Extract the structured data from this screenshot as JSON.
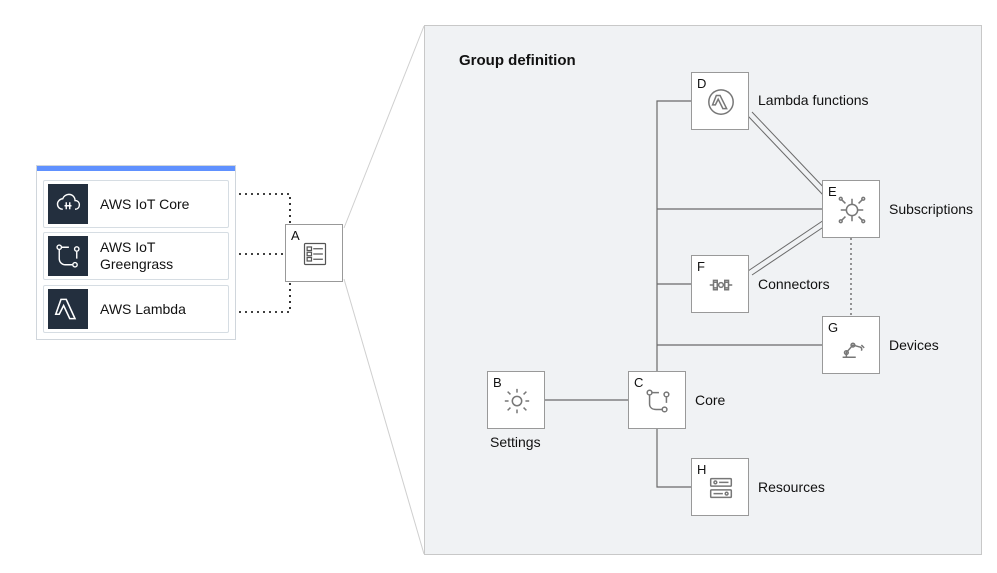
{
  "services_panel": {
    "items": [
      {
        "label": "AWS IoT Core",
        "icon": "aws-iot-core"
      },
      {
        "label": "AWS IoT\nGreengrass",
        "icon": "aws-iot-greengrass"
      },
      {
        "label": "AWS Lambda",
        "icon": "aws-lambda"
      }
    ]
  },
  "node_A": {
    "letter": "A",
    "label": "",
    "icon": "config-list"
  },
  "group": {
    "title": "Group definition",
    "nodes": {
      "B": {
        "letter": "B",
        "label": "Settings",
        "icon": "gear"
      },
      "C": {
        "letter": "C",
        "label": "Core",
        "icon": "core-circuit"
      },
      "D": {
        "letter": "D",
        "label": "Lambda functions",
        "icon": "lambda-outline"
      },
      "E": {
        "letter": "E",
        "label": "Subscriptions",
        "icon": "subscriptions"
      },
      "F": {
        "letter": "F",
        "label": "Connectors",
        "icon": "connectors"
      },
      "G": {
        "letter": "G",
        "label": "Devices",
        "icon": "robot-arm"
      },
      "H": {
        "letter": "H",
        "label": "Resources",
        "icon": "resources"
      }
    }
  },
  "colors": {
    "accent_bar": "#6091ff",
    "dark_icon_bg": "#232f3e",
    "group_bg": "#f0f2f4"
  }
}
